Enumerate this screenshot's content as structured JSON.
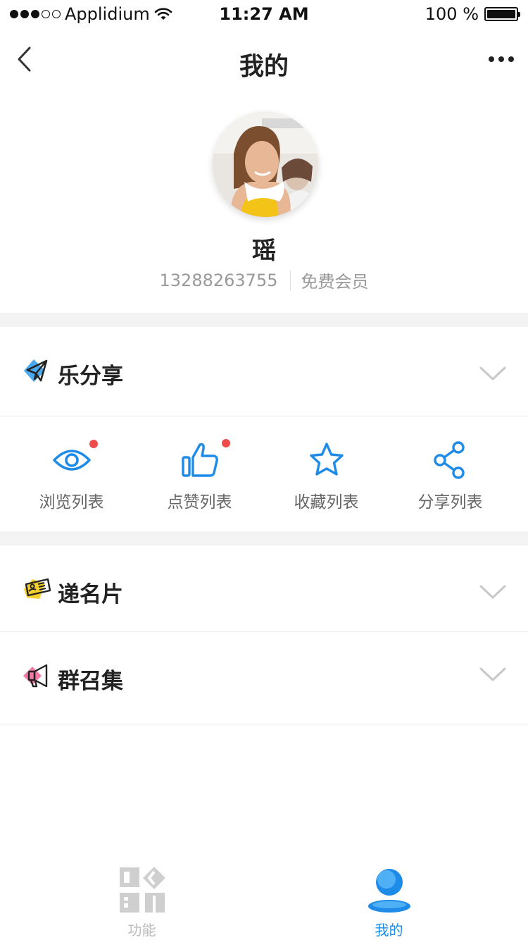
{
  "status_bar": {
    "carrier": "Applidium",
    "time": "11:27 AM",
    "battery": "100 %"
  },
  "nav": {
    "title": "我的"
  },
  "profile": {
    "name": "瑶",
    "phone": "13288263755",
    "membership": "免费会员"
  },
  "sections": {
    "share": {
      "label": "乐分享",
      "icon": "paper-plane-icon",
      "icon_bg": "#4aa8f0"
    },
    "card": {
      "label": "递名片",
      "icon": "business-card-icon",
      "icon_bg": "#f5cf2a"
    },
    "gather": {
      "label": "群召集",
      "icon": "megaphone-icon",
      "icon_bg": "#f27aa6"
    }
  },
  "lists": [
    {
      "label": "浏览列表",
      "icon": "eye-icon",
      "badge": true
    },
    {
      "label": "点赞列表",
      "icon": "thumbs-up-icon",
      "badge": true
    },
    {
      "label": "收藏列表",
      "icon": "star-icon",
      "badge": false
    },
    {
      "label": "分享列表",
      "icon": "share-icon",
      "badge": false
    }
  ],
  "tabs": [
    {
      "label": "功能",
      "icon": "grid-icon",
      "active": false
    },
    {
      "label": "我的",
      "icon": "user-icon",
      "active": true
    }
  ],
  "colors": {
    "accent": "#1e8be8",
    "badge": "#f04b4b",
    "inactive_tab": "#bbbbbb"
  }
}
